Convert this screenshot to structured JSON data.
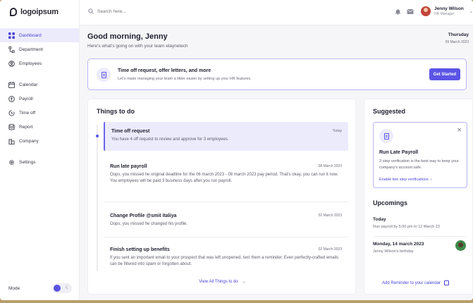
{
  "brand": {
    "logo_text": "logoipsum"
  },
  "sidebar": {
    "items": [
      {
        "label": "Dashboard",
        "icon": "grid-icon"
      },
      {
        "label": "Department",
        "icon": "hierarchy-icon"
      },
      {
        "label": "Employees",
        "icon": "users-icon"
      },
      {
        "label": "Calendar",
        "icon": "calendar-icon"
      },
      {
        "label": "Payroll",
        "icon": "coin-icon"
      },
      {
        "label": "Time off",
        "icon": "clock-icon"
      },
      {
        "label": "Report",
        "icon": "database-icon"
      },
      {
        "label": "Company",
        "icon": "building-icon"
      },
      {
        "label": "Settings",
        "icon": "gear-icon"
      }
    ],
    "mode_label": "Mode"
  },
  "topbar": {
    "search_placeholder": "Search here...",
    "user_name": "Jenny Wilson",
    "user_role": "HR Manager"
  },
  "greeting": {
    "title": "Good morning, Jenny",
    "subtitle": "Here's what's going on with your team elaynetech",
    "day": "Thursday",
    "date": "09 March 2023"
  },
  "banner": {
    "title": "Time off request, offer letters, and more",
    "subtitle": "Let's make managing your team a littler easier by setting up your HR features.",
    "button": "Get Started"
  },
  "todo": {
    "title": "Things to do",
    "items": [
      {
        "title": "Time off request",
        "date": "Today",
        "desc": "You have 4 off request to review and approve for 3 employees."
      },
      {
        "title": "Run late payroll",
        "date": "08 March 2023",
        "desc": "Oops, you missed he original deadline for the 06 march 2023 - 08 march 2023 pay period. That's okay, you can run it now. You employees will be paid 3 business days after you run payroll."
      },
      {
        "title": "Change Profile @smit italiya",
        "date": "02 March 2023",
        "desc": "Oops, you missed he changed his profile."
      },
      {
        "title": "Finish setting up benefits",
        "date": "02 March 2023",
        "desc": "If you sent an important email to your prospect that was left unopened, text them a reminder. Even perfectly-crafted emails can be filtered into spam or forgotten about."
      }
    ],
    "view_all": "View All Things to do"
  },
  "suggested": {
    "title": "Suggested",
    "card_title": "Run Late Payroll",
    "card_desc": "2-step verification is the best way to keep your company's account safe.",
    "card_link": "Enable two step verifications"
  },
  "upcomings": {
    "title": "Upcomings",
    "items": [
      {
        "name": "Today",
        "sub": "Run payroll by 5:00 pm to 12 March 23"
      },
      {
        "name": "Monday, 14 march 2023",
        "sub": "Jenny Wilson's birthday"
      }
    ],
    "reminder": "Add Reminder to your calendar"
  }
}
